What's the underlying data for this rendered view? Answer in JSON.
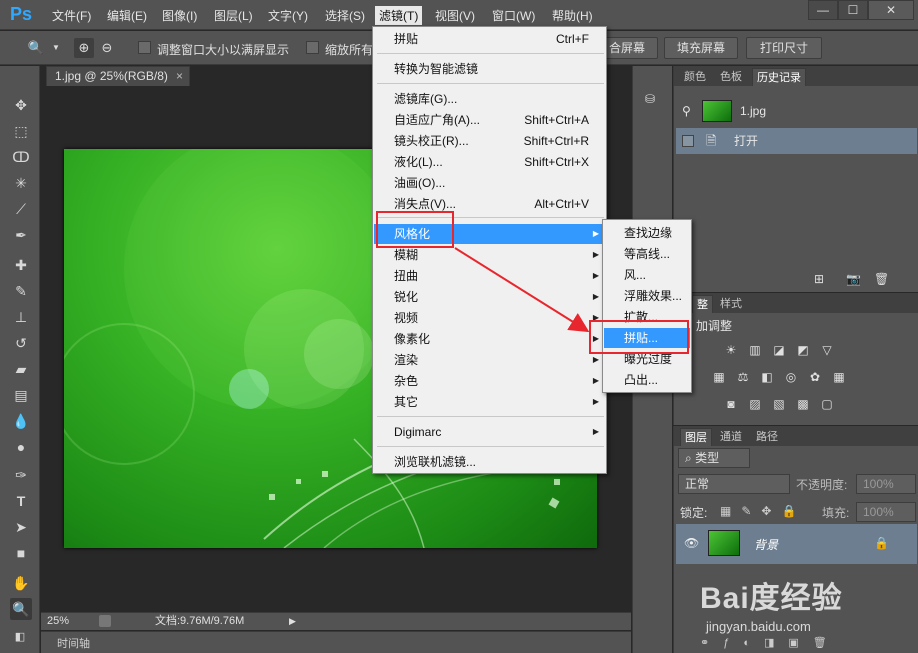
{
  "app": {
    "logo": "Ps"
  },
  "menubar": {
    "items": [
      "文件(F)",
      "编辑(E)",
      "图像(I)",
      "图层(L)",
      "文字(Y)",
      "选择(S)",
      "滤镜(T)",
      "视图(V)",
      "窗口(W)",
      "帮助(H)"
    ],
    "active": "滤镜(T)"
  },
  "window_controls": {
    "minimize": "—",
    "maximize": "☐",
    "close": "✕"
  },
  "options": {
    "check1_label": "调整窗口大小以满屏显示",
    "check2_label": "缩放所有",
    "btn_fill_screen_partial": "合屏幕",
    "btn_fill_screen": "填充屏幕",
    "btn_print_size": "打印尺寸"
  },
  "document": {
    "tab_title": "1.jpg @ 25%(RGB/8)",
    "tab_close": "×",
    "zoom": "25%",
    "doc_size": "文档:9.76M/9.76M",
    "timeline_tab": "时间轴"
  },
  "filter_menu": {
    "items": [
      {
        "label": "拼贴",
        "shortcut": "Ctrl+F"
      },
      {
        "label": "转换为智能滤镜",
        "shortcut": ""
      },
      {
        "label": "滤镜库(G)...",
        "shortcut": ""
      },
      {
        "label": "自适应广角(A)...",
        "shortcut": "Shift+Ctrl+A"
      },
      {
        "label": "镜头校正(R)...",
        "shortcut": "Shift+Ctrl+R"
      },
      {
        "label": "液化(L)...",
        "shortcut": "Shift+Ctrl+X"
      },
      {
        "label": "油画(O)...",
        "shortcut": ""
      },
      {
        "label": "消失点(V)...",
        "shortcut": "Alt+Ctrl+V"
      },
      {
        "label": "风格化",
        "shortcut": ""
      },
      {
        "label": "模糊",
        "shortcut": ""
      },
      {
        "label": "扭曲",
        "shortcut": ""
      },
      {
        "label": "锐化",
        "shortcut": ""
      },
      {
        "label": "视频",
        "shortcut": ""
      },
      {
        "label": "像素化",
        "shortcut": ""
      },
      {
        "label": "渲染",
        "shortcut": ""
      },
      {
        "label": "杂色",
        "shortcut": ""
      },
      {
        "label": "其它",
        "shortcut": ""
      },
      {
        "label": "Digimarc",
        "shortcut": ""
      },
      {
        "label": "浏览联机滤镜...",
        "shortcut": ""
      }
    ]
  },
  "stylize_submenu": {
    "items": [
      "查找边缘",
      "等高线...",
      "风...",
      "浮雕效果...",
      "扩散...",
      "拼贴...",
      "曝光过度",
      "凸出..."
    ],
    "highlighted": "拼贴..."
  },
  "history_panel": {
    "tabs": [
      "颜色",
      "色板",
      "历史记录"
    ],
    "active_tab": "历史记录",
    "snapshot": "1.jpg",
    "states": [
      "打开"
    ]
  },
  "adjust_panel": {
    "tabs": [
      "整",
      "样式"
    ],
    "title": "加调整"
  },
  "layers_panel": {
    "tabs": [
      "图层",
      "通道",
      "路径"
    ],
    "kind": "类型",
    "blend_mode": "正常",
    "opacity_label": "不透明度:",
    "opacity_value": "100%",
    "lock_label": "锁定:",
    "fill_label": "填充:",
    "fill_value": "100%",
    "layer_name": "背景"
  },
  "watermark": {
    "main": "Bai度经验",
    "sub": "jingyan.baidu.com"
  }
}
